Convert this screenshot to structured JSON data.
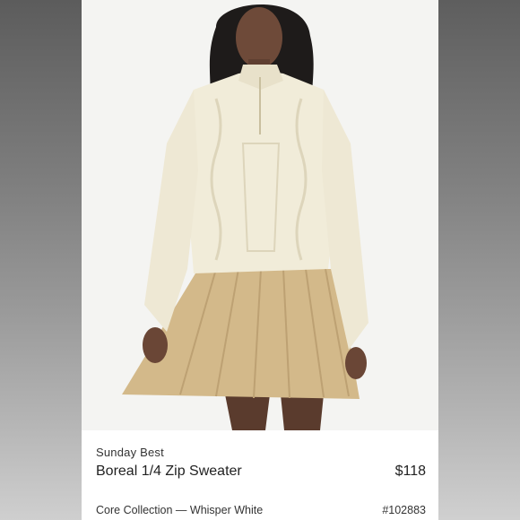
{
  "product": {
    "brand": "Sunday Best",
    "title": "Boreal 1/4 Zip Sweater",
    "price": "$118",
    "collection": "Core Collection — Whisper White",
    "sku": "#102883"
  },
  "photo": {
    "subject": "model-wearing-cream-cable-knit-sweater-and-beige-pleated-skirt"
  },
  "colors": {
    "sweater": "#f1ecd9",
    "skirt": "#d3b98a",
    "background": "#f4f4f2",
    "text": "#222222"
  }
}
